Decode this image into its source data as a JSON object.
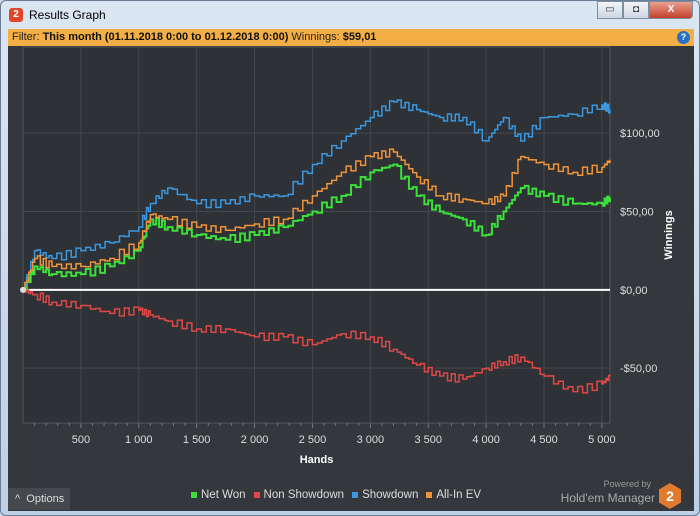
{
  "window": {
    "title": "Results Graph",
    "minimize": "▭",
    "restore": "◘",
    "close": "X"
  },
  "filter": {
    "label": "Filter:",
    "value": "This month (01.11.2018 0:00 to 01.12.2018 0:00)",
    "winnings_label": "Winnings:",
    "winnings": "$59,01",
    "help": "?"
  },
  "options_label": "Options",
  "options_icon": "^",
  "powered_by": "Powered by",
  "brand": "Hold'em Manager",
  "brand_badge": "2",
  "chart_data": {
    "type": "line",
    "xlabel": "Hands",
    "ylabel": "Winnings",
    "xlim": [
      0,
      5070
    ],
    "ylim": [
      -85,
      155
    ],
    "x_ticks": [
      500,
      1000,
      1500,
      2000,
      2500,
      3000,
      3500,
      4000,
      4500,
      5000
    ],
    "x_tick_labels": [
      "500",
      "1 000",
      "1 500",
      "2 000",
      "2 500",
      "3 000",
      "3 500",
      "4 000",
      "4 500",
      "5 000"
    ],
    "y_ticks": [
      -50,
      0,
      50,
      100
    ],
    "y_tick_labels": [
      "-$50,00",
      "$0,00",
      "$50,00",
      "$100,00"
    ],
    "legend_position": "bottom",
    "x": [
      0,
      100,
      250,
      500,
      750,
      1000,
      1100,
      1250,
      1500,
      1750,
      2000,
      2250,
      2500,
      2750,
      3000,
      3200,
      3400,
      3600,
      3800,
      4000,
      4150,
      4300,
      4500,
      4750,
      5000,
      5070
    ],
    "series": [
      {
        "name": "Net Won",
        "color": "#3be03b",
        "values": [
          0,
          15,
          10,
          10,
          15,
          25,
          45,
          40,
          35,
          32,
          35,
          40,
          50,
          60,
          75,
          80,
          60,
          50,
          45,
          35,
          50,
          65,
          60,
          55,
          55,
          59
        ]
      },
      {
        "name": "Non Showdown",
        "color": "#e04848",
        "values": [
          0,
          -3,
          -8,
          -10,
          -15,
          -13,
          -16,
          -20,
          -25,
          -25,
          -30,
          -30,
          -35,
          -28,
          -30,
          -38,
          -48,
          -55,
          -57,
          -50,
          -46,
          -43,
          -55,
          -65,
          -60,
          -55
        ]
      },
      {
        "name": "Showdown",
        "color": "#3b98e0",
        "values": [
          0,
          25,
          20,
          25,
          30,
          40,
          55,
          65,
          55,
          55,
          60,
          60,
          80,
          95,
          110,
          120,
          115,
          110,
          110,
          95,
          110,
          95,
          110,
          112,
          118,
          115
        ]
      },
      {
        "name": "All-In EV",
        "color": "#f0943a",
        "values": [
          0,
          20,
          15,
          15,
          20,
          30,
          48,
          45,
          40,
          38,
          42,
          45,
          60,
          75,
          85,
          88,
          72,
          60,
          58,
          55,
          60,
          85,
          80,
          75,
          78,
          83
        ]
      }
    ]
  }
}
